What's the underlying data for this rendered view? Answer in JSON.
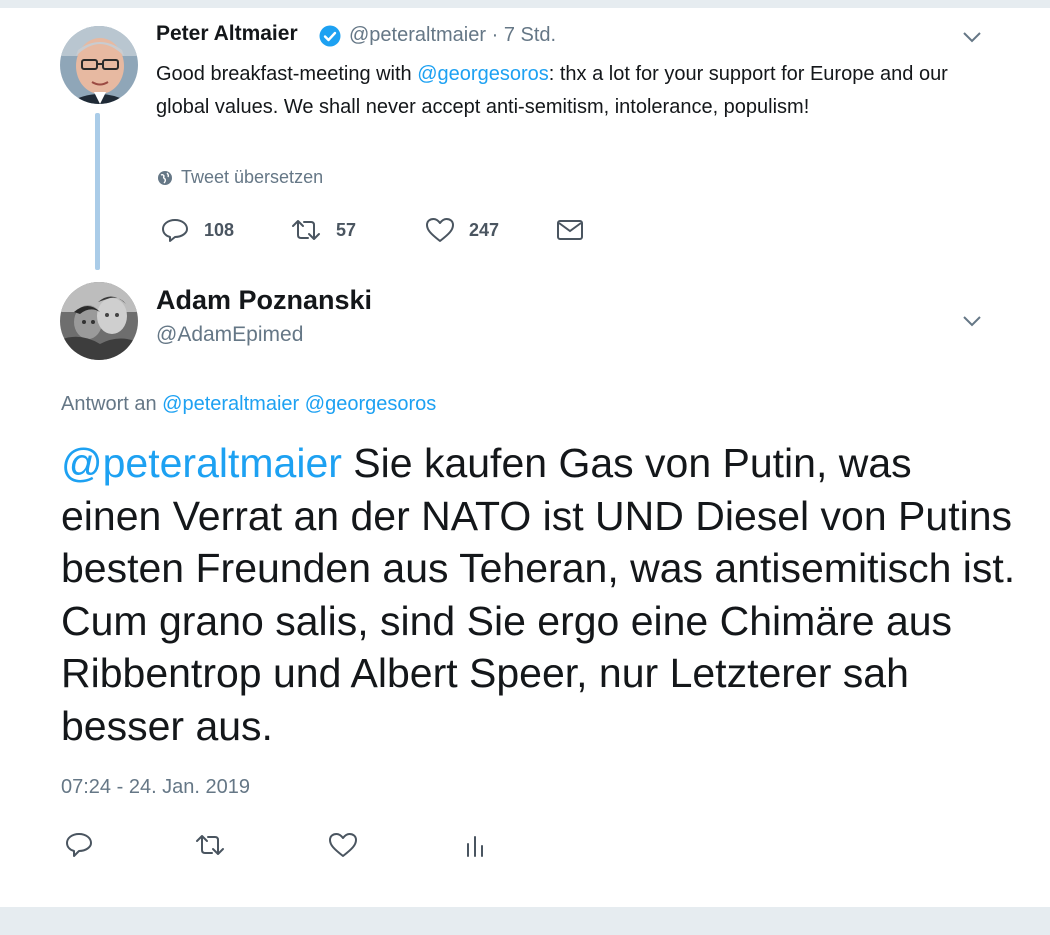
{
  "parent_tweet": {
    "author_name": "Peter Altmaier",
    "handle": "@peteraltmaier",
    "separator": "·",
    "time": "7 Std.",
    "text_before": "Good breakfast-meeting with ",
    "mention": "@georgesoros",
    "text_after": ": thx a lot for your support for Europe and our global values. We shall never accept anti-semitism, intolerance, populism!",
    "translate_label": "Tweet übersetzen",
    "replies": "108",
    "retweets": "57",
    "likes": "247"
  },
  "reply_tweet": {
    "author_name": "Adam Poznanski",
    "handle": "@AdamEpimed",
    "reply_prefix": "Antwort an",
    "reply_to_1": "@peteraltmaier",
    "reply_to_2": "@georgesoros",
    "mention": "@peteraltmaier",
    "text": " Sie kaufen Gas von Putin, was einen Verrat an der NATO ist UND Diesel von Putins besten Freunden aus Teheran, was antisemitisch ist. Cum grano salis, sind Sie ergo eine Chimäre aus Ribbentrop und Albert Speer, nur Letzterer sah besser aus.",
    "timestamp": "07:24 - 24. Jan. 2019"
  },
  "icons": {
    "verified": "verified-badge-icon",
    "chevron": "chevron-down-icon",
    "globe": "globe-icon",
    "reply": "reply-icon",
    "retweet": "retweet-icon",
    "like": "heart-icon",
    "dm": "envelope-icon",
    "analytics": "analytics-icon"
  },
  "colors": {
    "link": "#1da1f2",
    "secondary_text": "#657786",
    "thread_line": "#aacce8",
    "background_band": "#e6ecf0"
  }
}
